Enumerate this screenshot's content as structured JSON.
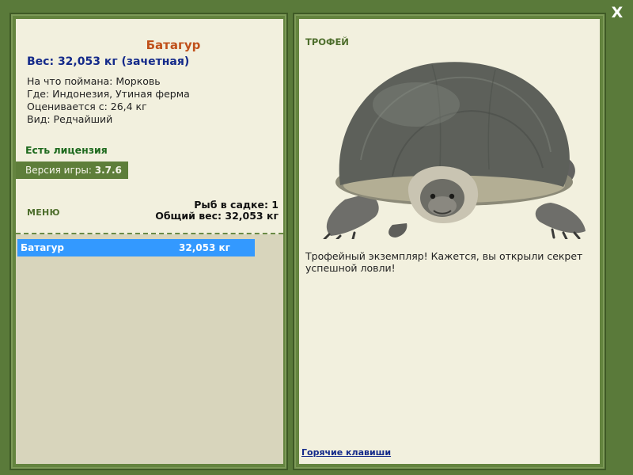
{
  "close_label": "X",
  "fish": {
    "name": "Батагур",
    "weight": "Вес: 32,053 кг (зачетная)",
    "caught_on": "На что поймана: Морковь",
    "location": "Где: Индонезия, Утиная ферма",
    "valued_from": "Оценивается с: 26,4 кг",
    "rarity": "Вид: Редчайший"
  },
  "license": "Есть лицензия",
  "version": {
    "label": "Версия игры:",
    "value": "3.7.6"
  },
  "menu_label": "МЕНЮ",
  "stats": {
    "fish_count": "Рыб в садке: 1",
    "total_weight": "Общий вес: 32,053 кг"
  },
  "keepnet": [
    {
      "name": "Батагур",
      "weight": "32,053 кг",
      "selected": true
    }
  ],
  "trophy": {
    "title": "ТРОФЕЙ",
    "image": "turtle-photo",
    "text": "Трофейный экземпляр! Кажется, вы открыли секрет успешной ловли!"
  },
  "hotkeys_label": "Горячие клавиши",
  "colors": {
    "background": "#5a7a3a",
    "panel": "#f2f0de",
    "selected_row": "#3399ff",
    "fish_name": "#c0501a",
    "weight": "#142a8a"
  }
}
